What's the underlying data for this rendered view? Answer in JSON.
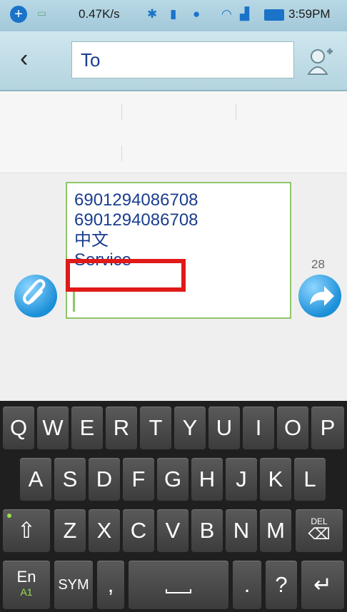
{
  "status_bar": {
    "net_speed": "0.47K/s",
    "time": "3:59PM"
  },
  "header": {
    "back_icon": "chevron-left-icon",
    "to_placeholder": "To",
    "add_contact_icon": "add-contact-icon"
  },
  "compose": {
    "lines": [
      "6901294086708",
      "6901294086708",
      "中文",
      "Service"
    ],
    "char_count": "28",
    "attach_icon": "paperclip-icon",
    "send_icon": "send-arrow-icon"
  },
  "keyboard": {
    "row1": [
      "Q",
      "W",
      "E",
      "R",
      "T",
      "Y",
      "U",
      "I",
      "O",
      "P"
    ],
    "row2": [
      "A",
      "S",
      "D",
      "F",
      "G",
      "H",
      "J",
      "K",
      "L"
    ],
    "row3": [
      "Z",
      "X",
      "C",
      "V",
      "B",
      "N",
      "M"
    ],
    "lang_key": "En",
    "lang_sub": "A1",
    "sym_key": "SYM",
    "comma_key": ",",
    "period_key": ".",
    "question_key": "?",
    "del_label": "DEL"
  }
}
